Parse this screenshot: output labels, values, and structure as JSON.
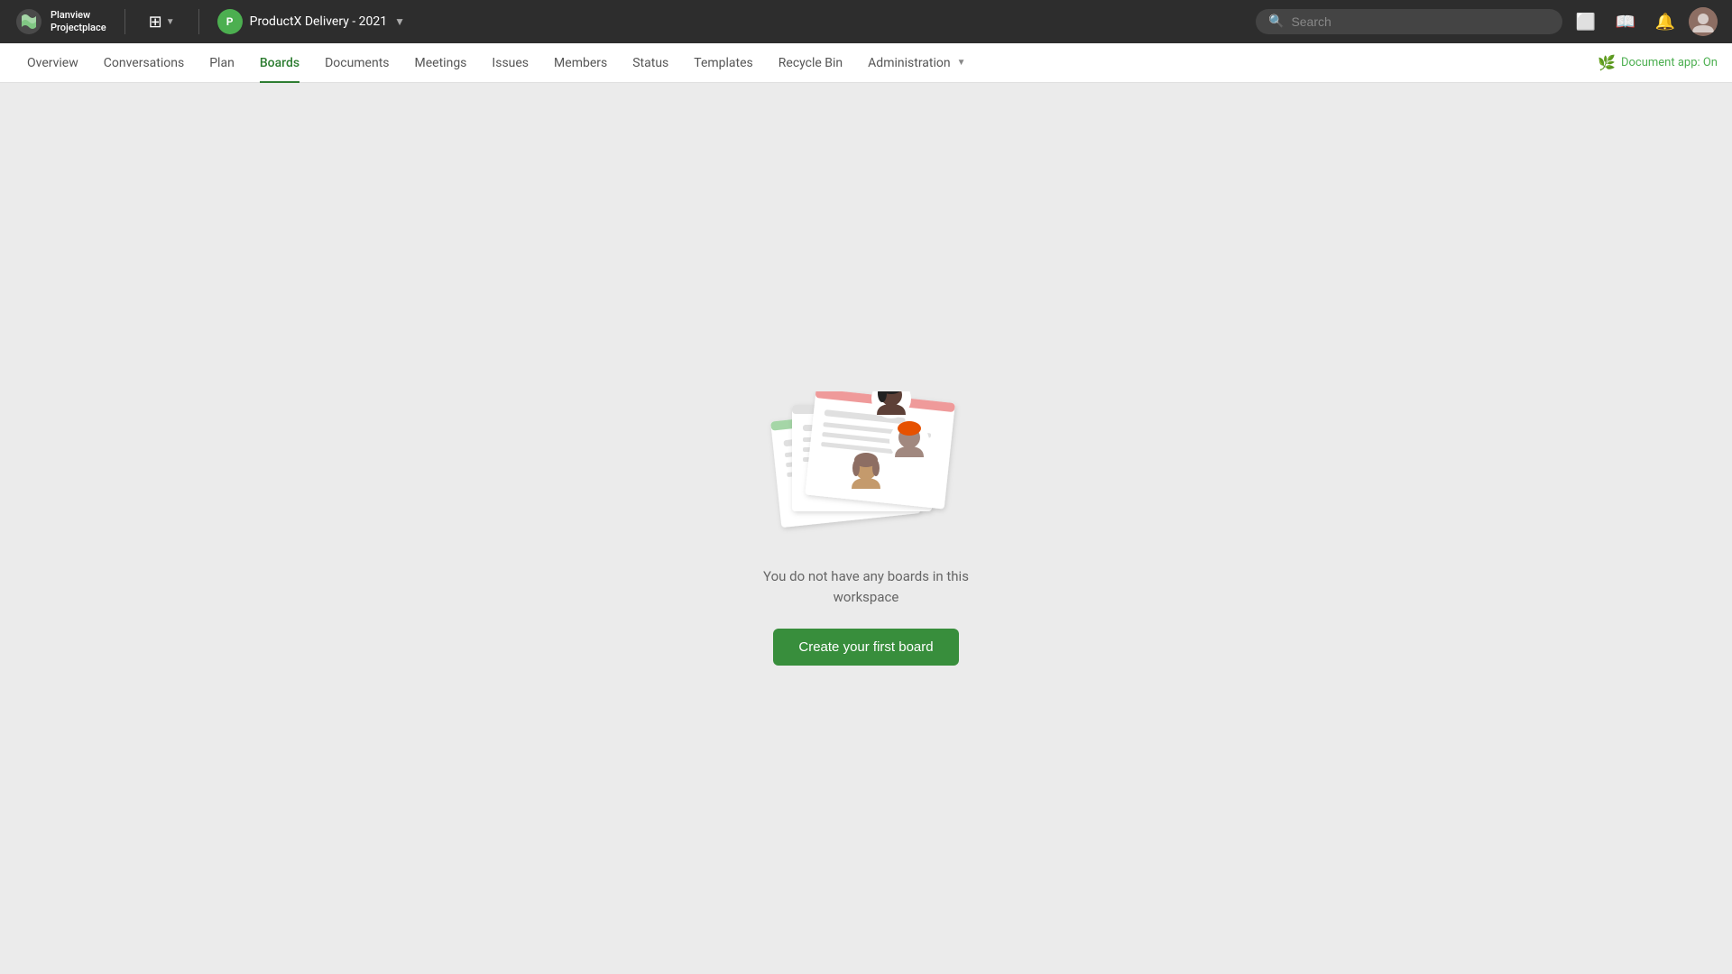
{
  "topbar": {
    "logo_text": "Planview\nProjectplace",
    "project_name": "ProductX Delivery - 2021",
    "project_initial": "P",
    "search_placeholder": "Search",
    "document_app_label": "Document app: On"
  },
  "secondary_nav": {
    "items": [
      {
        "label": "Overview",
        "active": false
      },
      {
        "label": "Conversations",
        "active": false
      },
      {
        "label": "Plan",
        "active": false
      },
      {
        "label": "Boards",
        "active": true
      },
      {
        "label": "Documents",
        "active": false
      },
      {
        "label": "Meetings",
        "active": false
      },
      {
        "label": "Issues",
        "active": false
      },
      {
        "label": "Members",
        "active": false
      },
      {
        "label": "Status",
        "active": false
      },
      {
        "label": "Templates",
        "active": false
      },
      {
        "label": "Recycle Bin",
        "active": false
      },
      {
        "label": "Administration",
        "active": false,
        "has_arrow": true
      }
    ]
  },
  "empty_state": {
    "message_line1": "You do not have any boards in this",
    "message_line2": "workspace",
    "cta_label": "Create your first board"
  },
  "colors": {
    "active_nav": "#2e7d32",
    "cta_bg": "#388e3c",
    "accent_green": "#4caf50"
  }
}
